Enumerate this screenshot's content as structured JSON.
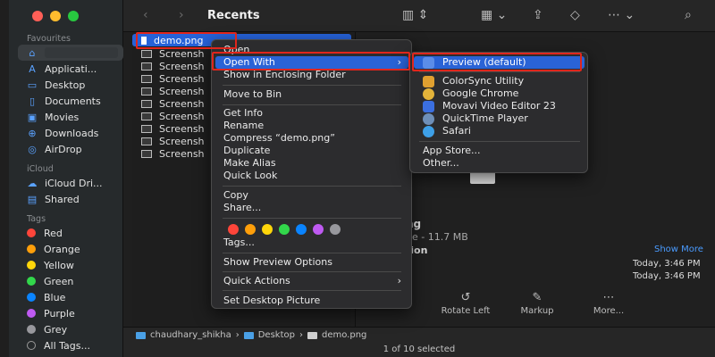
{
  "toolbar": {
    "title": "Recents",
    "icons": [
      "back-icon",
      "forward-icon",
      "view-columns-icon",
      "group-icon",
      "share-icon",
      "tag-icon",
      "more-icon",
      "search-icon"
    ]
  },
  "sidebar": {
    "favourites_label": "Favourites",
    "favourites": [
      {
        "label": "",
        "icon": "home-icon"
      },
      {
        "label": "Applicati...",
        "icon": "applications-icon"
      },
      {
        "label": "Desktop",
        "icon": "desktop-icon"
      },
      {
        "label": "Documents",
        "icon": "documents-icon"
      },
      {
        "label": "Movies",
        "icon": "movies-icon"
      },
      {
        "label": "Downloads",
        "icon": "downloads-icon"
      },
      {
        "label": "AirDrop",
        "icon": "airdrop-icon"
      }
    ],
    "icloud_label": "iCloud",
    "icloud": [
      {
        "label": "iCloud Dri...",
        "icon": "icloud-icon"
      },
      {
        "label": "Shared",
        "icon": "shared-icon"
      }
    ],
    "tags_label": "Tags",
    "tags": [
      {
        "label": "Red",
        "color": "#ff453a"
      },
      {
        "label": "Orange",
        "color": "#ff9f0a"
      },
      {
        "label": "Yellow",
        "color": "#ffd60a"
      },
      {
        "label": "Green",
        "color": "#32d74b"
      },
      {
        "label": "Blue",
        "color": "#0a84ff"
      },
      {
        "label": "Purple",
        "color": "#bf5af2"
      },
      {
        "label": "Grey",
        "color": "#98989d"
      },
      {
        "label": "All Tags...",
        "color": ""
      }
    ]
  },
  "files": [
    {
      "name": "demo.png",
      "selected": true
    },
    {
      "name": "Screensh",
      "selected": false
    },
    {
      "name": "Screensh",
      "selected": false
    },
    {
      "name": "Screensh",
      "selected": false
    },
    {
      "name": "Screensh",
      "selected": false
    },
    {
      "name": "Screensh",
      "selected": false
    },
    {
      "name": "Screensh",
      "selected": false
    },
    {
      "name": "Screensh",
      "selected": false
    },
    {
      "name": "Screensh",
      "selected": false
    },
    {
      "name": "Screensh",
      "selected": false
    }
  ],
  "context_menu": {
    "open": "Open",
    "open_with": "Open With",
    "show_in_folder": "Show in Enclosing Folder",
    "move_to_bin": "Move to Bin",
    "get_info": "Get Info",
    "rename": "Rename",
    "compress": "Compress “demo.png”",
    "duplicate": "Duplicate",
    "make_alias": "Make Alias",
    "quick_look": "Quick Look",
    "copy": "Copy",
    "share": "Share...",
    "tag_colors": [
      "#ff453a",
      "#ff9f0a",
      "#ffd60a",
      "#32d74b",
      "#0a84ff",
      "#bf5af2",
      "#98989d"
    ],
    "tags": "Tags...",
    "show_preview_options": "Show Preview Options",
    "quick_actions": "Quick Actions",
    "set_desktop_picture": "Set Desktop Picture",
    "arrow": "›"
  },
  "open_with_menu": {
    "items": [
      {
        "label": "Preview (default)",
        "color": "#5b8de8"
      },
      {
        "label": "ColorSync Utility",
        "color": "#e0a030"
      },
      {
        "label": "Google Chrome",
        "color": "#e3b33a"
      },
      {
        "label": "Movavi Video Editor 23",
        "color": "#3b6fe0"
      },
      {
        "label": "QuickTime Player",
        "color": "#6e8fb8"
      },
      {
        "label": "Safari",
        "color": "#3ea0e8"
      }
    ],
    "app_store": "App Store...",
    "other": "Other..."
  },
  "preview": {
    "name_fragment": "ng",
    "size_fragment": "ge - 11.7 MB",
    "info_fragment": "tion",
    "show_more": "Show More",
    "date1": "Today, 3:46 PM",
    "date2": "Today, 3:46 PM",
    "actions": [
      {
        "label": "Rotate Left",
        "icon": "rotate-left-icon"
      },
      {
        "label": "Markup",
        "icon": "markup-icon"
      },
      {
        "label": "More...",
        "icon": "more-icon"
      }
    ]
  },
  "pathbar": {
    "segments": [
      "chaudhary_shikha",
      "Desktop",
      "demo.png"
    ],
    "separator": "›"
  },
  "status": {
    "text": "1 of 10 selected"
  },
  "colors": {
    "accent": "#2a63d6",
    "annotation": "#e0261c",
    "close": "#ff5f57",
    "minimize": "#febc2e",
    "zoom": "#28c840"
  }
}
